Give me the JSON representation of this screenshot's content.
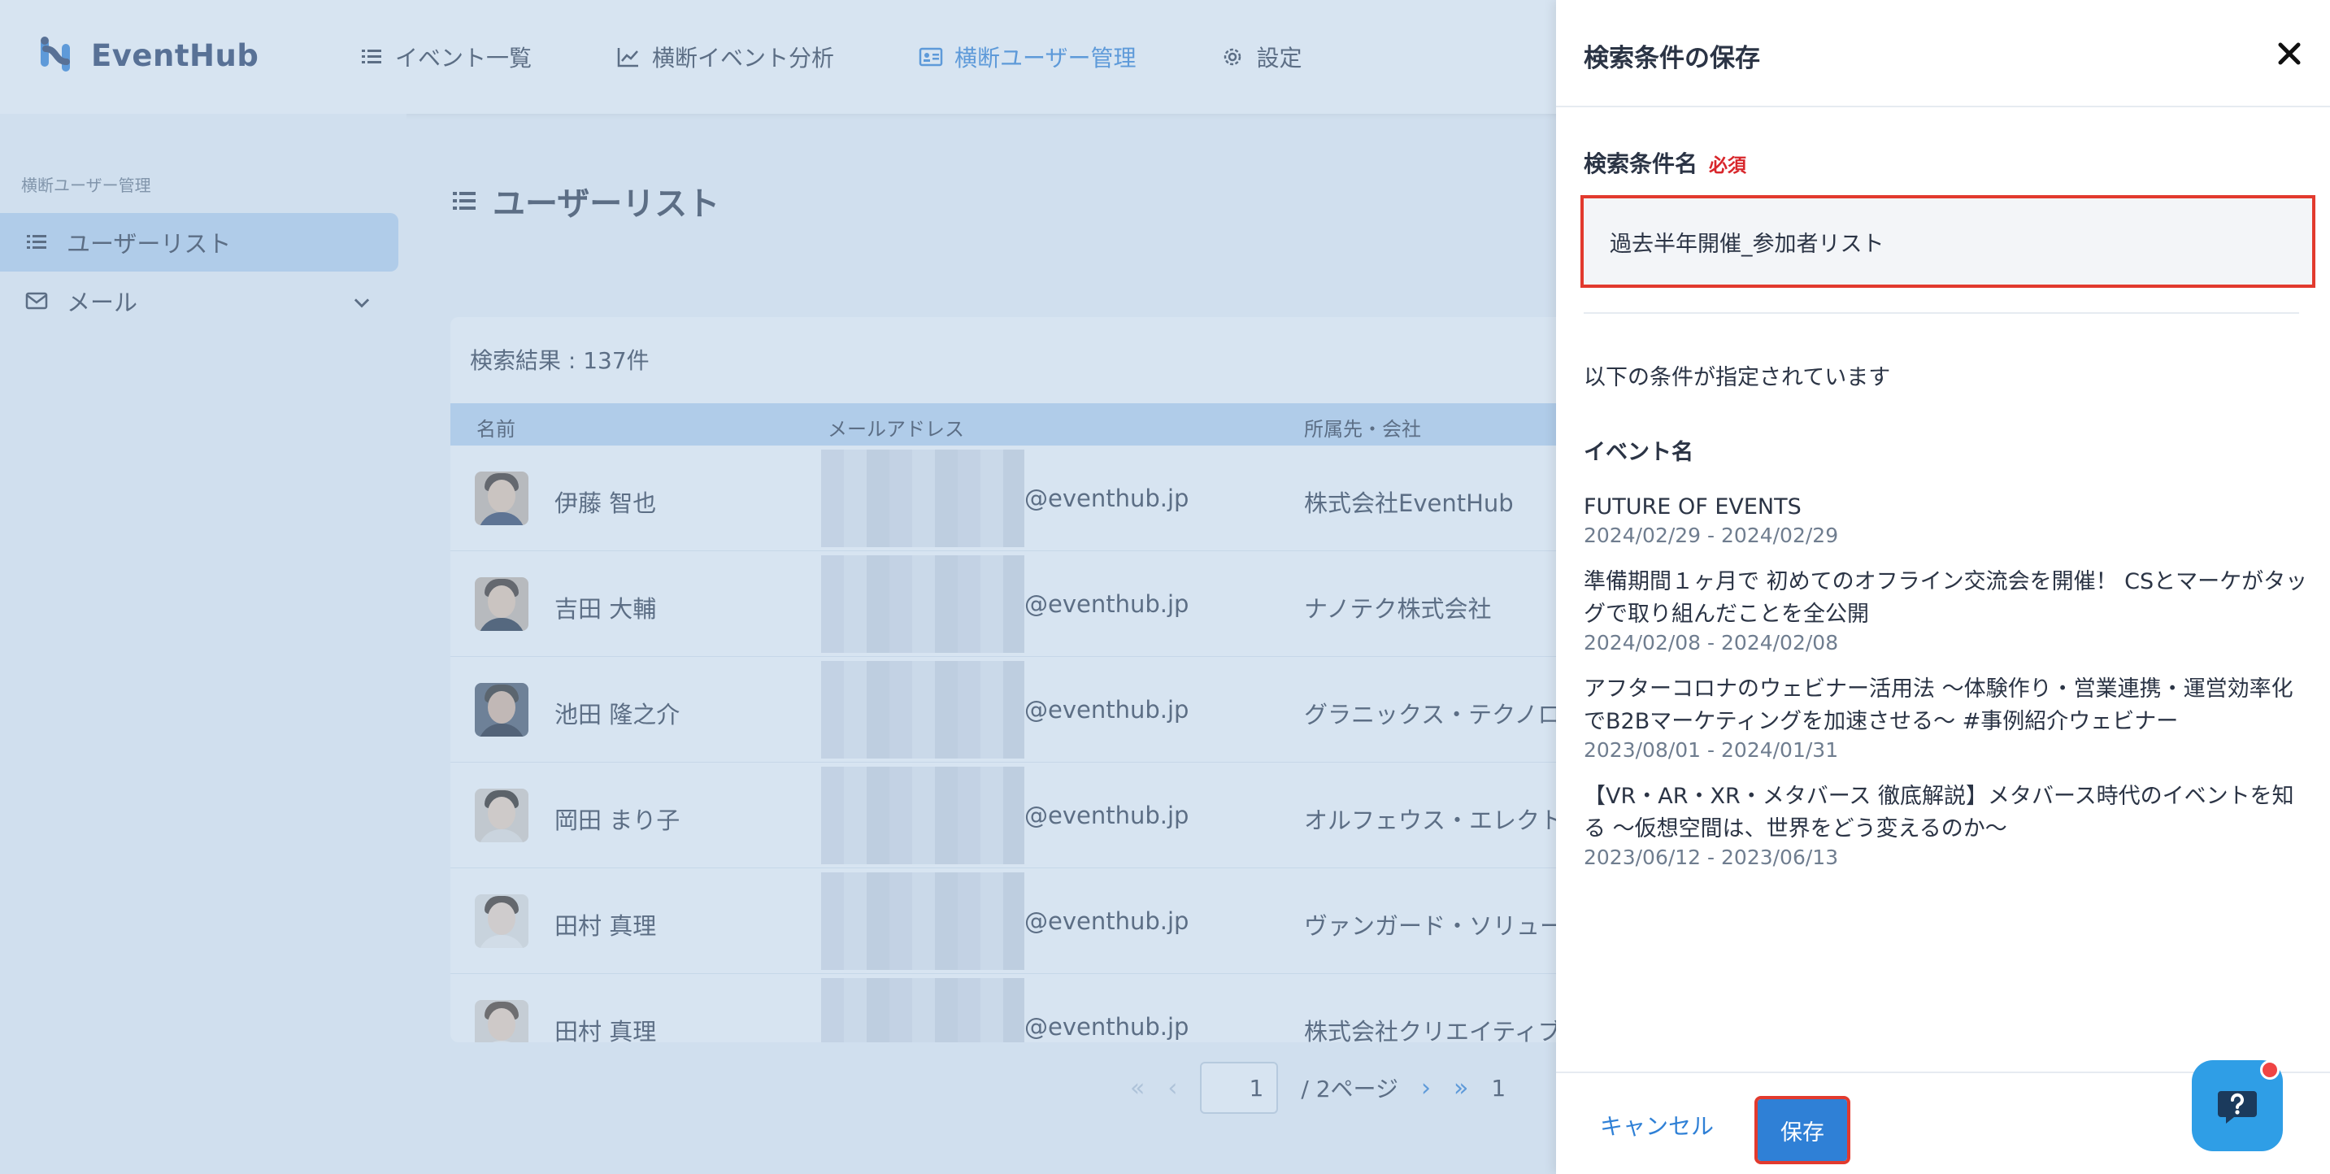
{
  "app": {
    "logo_text": "EventHub",
    "nav": [
      {
        "label": "イベント一覧"
      },
      {
        "label": "横断イベント分析"
      },
      {
        "label": "横断ユーザー管理",
        "active": true
      },
      {
        "label": "設定"
      }
    ]
  },
  "sidebar": {
    "caption": "横断ユーザー管理",
    "items": [
      {
        "label": "ユーザーリスト",
        "active": true
      },
      {
        "label": "メール"
      }
    ]
  },
  "main": {
    "title": "ユーザーリスト",
    "result_count": "検索結果 : 137件",
    "columns": [
      "名前",
      "メールアドレス",
      "所属先・会社"
    ],
    "rows": [
      {
        "name": "伊藤 智也",
        "email_domain": "@eventhub.jp",
        "company": "株式会社EventHub"
      },
      {
        "name": "吉田 大輔",
        "email_domain": "@eventhub.jp",
        "company": "ナノテク株式会社"
      },
      {
        "name": "池田 隆之介",
        "email_domain": "@eventhub.jp",
        "company": "グラニックス・テクノロ"
      },
      {
        "name": "岡田 まり子",
        "email_domain": "@eventhub.jp",
        "company": "オルフェウス・エレクト"
      },
      {
        "name": "田村 真理",
        "email_domain": "@eventhub.jp",
        "company": "ヴァンガード・ソリュー"
      },
      {
        "name": "田村 真理",
        "email_domain": "@eventhub.jp",
        "company": "株式会社クリエイティブ"
      }
    ],
    "pager": {
      "current": "1",
      "total": "/ 2ページ",
      "trailing": "1"
    }
  },
  "drawer": {
    "title": "検索条件の保存",
    "field_label": "検索条件名",
    "required": "必須",
    "field_value": "過去半年開催_参加者リスト",
    "conditions_text": "以下の条件が指定されています",
    "event_header": "イベント名",
    "events": [
      {
        "name": "FUTURE OF EVENTS",
        "date": "2024/02/29 - 2024/02/29"
      },
      {
        "name": "準備期間１ヶ月で 初めてのオフライン交流会を開催！ CSとマーケがタッグで取り組んだことを全公開",
        "date": "2024/02/08 - 2024/02/08"
      },
      {
        "name": "アフターコロナのウェビナー活用法 〜体験作り・営業連携・運営効率化でB2Bマーケティングを加速させる〜 #事例紹介ウェビナー",
        "date": "2023/08/01 - 2024/01/31"
      },
      {
        "name": "【VR・AR・XR・メタバース 徹底解説】メタバース時代のイベントを知る 〜仮想空間は、世界をどう変えるのか〜",
        "date": "2023/06/12 - 2023/06/13"
      }
    ],
    "cancel_label": "キャンセル",
    "save_label": "保存"
  },
  "colors": {
    "accent": "#2f80d6",
    "highlight": "#e23a2e",
    "required": "#d8262b"
  }
}
